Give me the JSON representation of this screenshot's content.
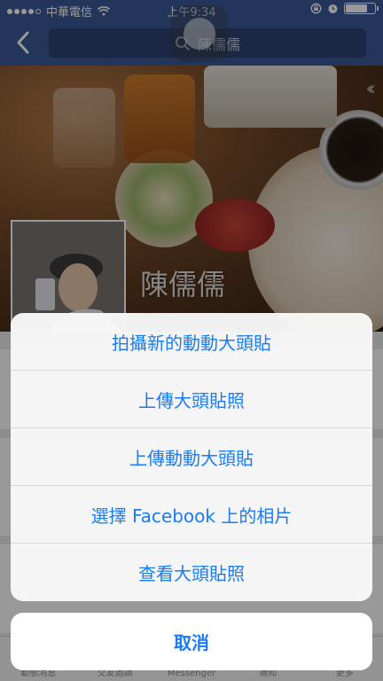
{
  "status_bar": {
    "carrier": "中華電信",
    "time": "上午9:34",
    "battery_level": 0.75
  },
  "nav": {
    "search_text": "陳儒儒"
  },
  "profile": {
    "name": "陳儒儒"
  },
  "tabs": [
    {
      "label": "動態消息",
      "icon": "news-feed-icon"
    },
    {
      "label": "交友邀請",
      "icon": "friends-icon"
    },
    {
      "label": "Messenger",
      "icon": "messenger-icon"
    },
    {
      "label": "通知",
      "icon": "bell-icon"
    },
    {
      "label": "更多",
      "icon": "menu-icon"
    }
  ],
  "action_sheet": {
    "items": [
      "拍攝新的動動大頭貼",
      "上傳大頭貼照",
      "上傳動動大頭貼",
      "選擇 Facebook 上的相片",
      "查看大頭貼照"
    ],
    "cancel": "取消"
  },
  "colors": {
    "nav_blue": "#3b5998",
    "action_blue": "#1a7cf5"
  }
}
